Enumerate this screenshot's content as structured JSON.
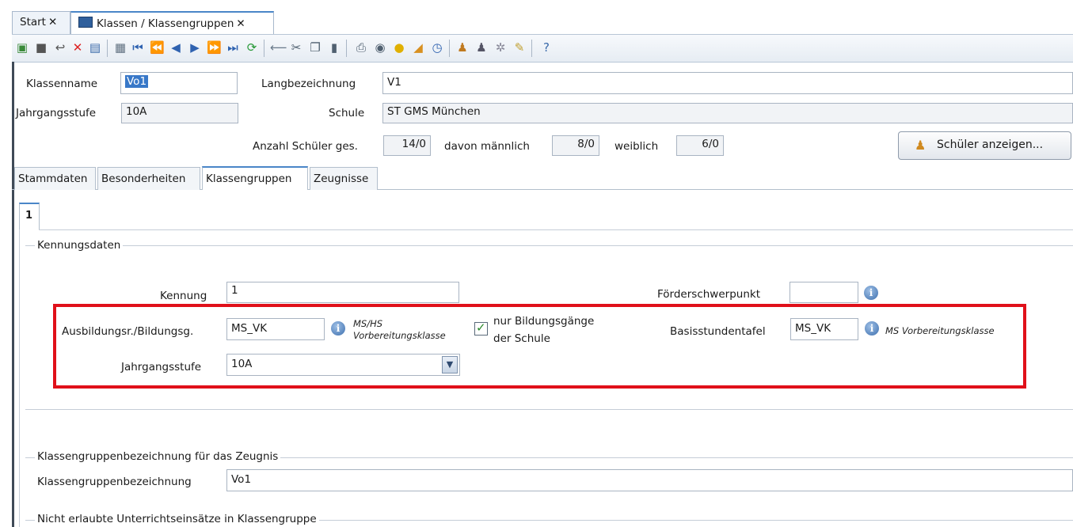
{
  "tabs": [
    {
      "label": "Start"
    },
    {
      "label": "Klassen / Klassengruppen"
    }
  ],
  "close_glyph": "✕",
  "toolbar_icons": [
    "new-icon",
    "save-icon",
    "undo-icon",
    "delete-icon",
    "properties-icon",
    "copy-record-icon",
    "first-icon",
    "fast-back-icon",
    "prev-icon",
    "next-icon",
    "fast-forward-icon",
    "last-icon",
    "refresh-icon",
    "back-arrow-icon",
    "cut-icon",
    "copy-icon",
    "paste-icon",
    "print-icon",
    "preview-icon",
    "lightbulb-icon",
    "eraser-icon",
    "timer-icon",
    "users-icon",
    "user-group-icon",
    "settings-icon",
    "edit-icon",
    "help-icon"
  ],
  "header": {
    "klassenname_label": "Klassenname",
    "klassenname_value": "Vo1",
    "langbez_label": "Langbezeichnung",
    "langbez_value": "V1",
    "jahrgang_label": "Jahrgangsstufe",
    "jahrgang_value": "10A",
    "schule_label": "Schule",
    "schule_value": "ST GMS München",
    "anzahl_label": "Anzahl Schüler ges.",
    "anzahl_value": "14/0",
    "maennlich_label": "davon männlich",
    "maennlich_value": "8/0",
    "weiblich_label": "weiblich",
    "weiblich_value": "6/0",
    "schueler_button": "Schüler anzeigen..."
  },
  "subtabs": [
    "Stammdaten",
    "Besonderheiten",
    "Klassengruppen",
    "Zeugnisse"
  ],
  "group_tab": "1",
  "kennung": {
    "section_title": "Kennungsdaten",
    "kennung_label": "Kennung",
    "kennung_value": "1",
    "foerder_label": "Förderschwerpunkt",
    "foerder_value": "",
    "ausbildung_label": "Ausbildungsr./Bildungsg.",
    "ausbildung_value": "MS_VK",
    "ausbildung_note_1": "MS/HS",
    "ausbildung_note_2": "Vorbereitungsklasse",
    "checkbox_label_1": "nur Bildungsgänge",
    "checkbox_label_2": "der Schule",
    "checkbox_checked": true,
    "basis_label": "Basisstundentafel",
    "basis_value": "MS_VK",
    "basis_note": "MS Vorbereitungsklasse",
    "jahrgang_label": "Jahrgangsstufe",
    "jahrgang_value": "10A"
  },
  "zeugnis": {
    "section_title": "Klassengruppenbezeichnung für das Zeugnis",
    "label": "Klassengruppenbezeichnung",
    "value": "Vo1"
  },
  "nicht_erlaubt": {
    "section_title": "Nicht erlaubte Unterrichtseinsätze in Klassengruppe"
  },
  "colors": {
    "highlight": "#e0101a",
    "accent": "#4a86c8",
    "selection": "#3878c8"
  }
}
